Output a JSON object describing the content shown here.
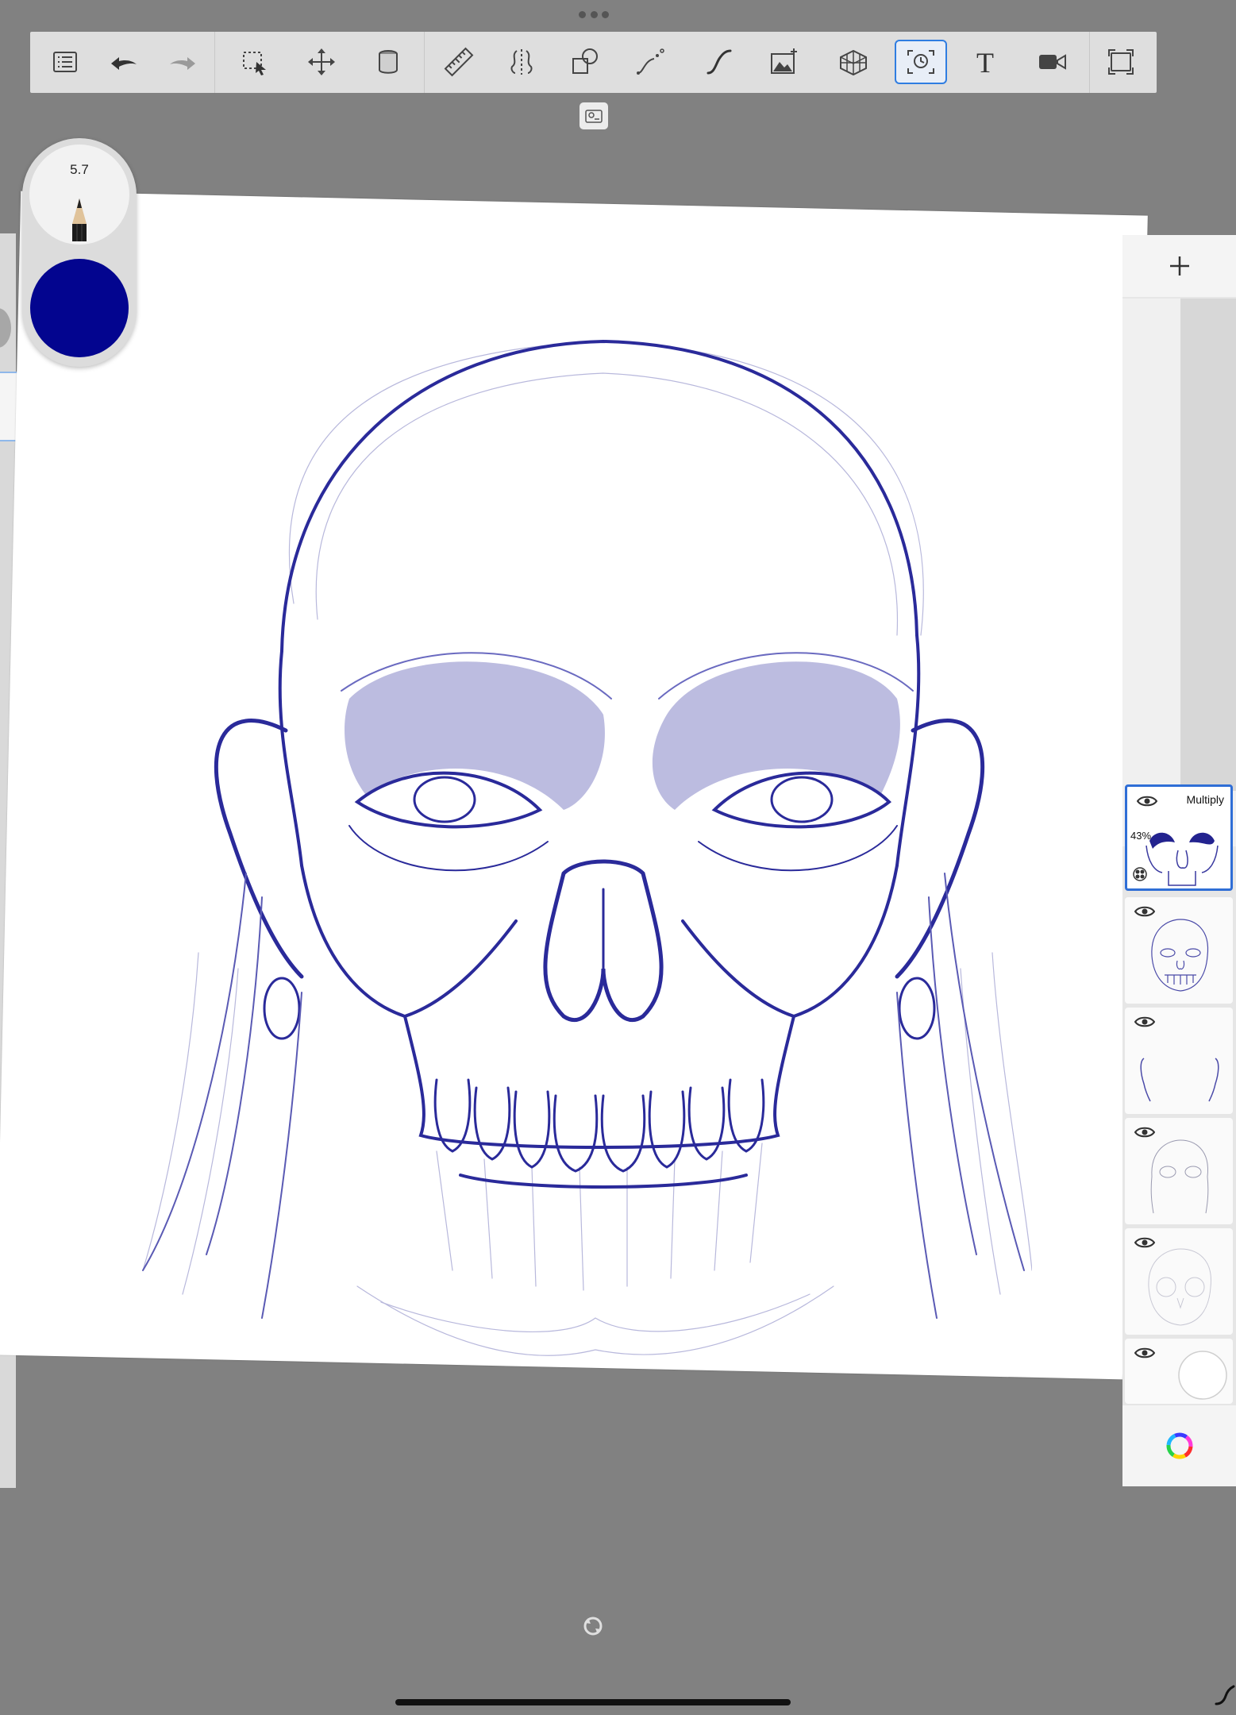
{
  "toolbar": {
    "tools": [
      {
        "name": "menu-list-icon"
      },
      {
        "name": "undo-icon"
      },
      {
        "name": "redo-icon"
      },
      {
        "name": "selection-icon"
      },
      {
        "name": "transform-icon"
      },
      {
        "name": "fill-bucket-icon"
      },
      {
        "name": "ruler-icon"
      },
      {
        "name": "symmetry-icon"
      },
      {
        "name": "shapes-icon"
      },
      {
        "name": "curve-icon"
      },
      {
        "name": "stroke-icon"
      },
      {
        "name": "add-image-icon"
      },
      {
        "name": "perspective-grid-icon"
      },
      {
        "name": "time-lapse-icon",
        "active": true
      },
      {
        "name": "text-icon"
      },
      {
        "name": "video-record-icon"
      },
      {
        "name": "fullscreen-icon"
      }
    ]
  },
  "brush": {
    "size": "5.7",
    "color": "#03058f",
    "tool": "pencil-icon"
  },
  "layers": {
    "add_label": "+",
    "items": [
      {
        "visible": true,
        "blend_mode": "Multiply",
        "opacity": "43%",
        "selected": true,
        "thumb": "eye-shadow-layer"
      },
      {
        "visible": true,
        "blend_mode": "",
        "opacity": "",
        "selected": false,
        "thumb": "skull-ink-layer"
      },
      {
        "visible": true,
        "blend_mode": "",
        "opacity": "",
        "selected": false,
        "thumb": "ears-layer"
      },
      {
        "visible": true,
        "blend_mode": "",
        "opacity": "",
        "selected": false,
        "thumb": "sketch-layer"
      },
      {
        "visible": true,
        "blend_mode": "",
        "opacity": "",
        "selected": false,
        "thumb": "rough-sketch-layer"
      },
      {
        "visible": true,
        "blend_mode": "",
        "opacity": "",
        "selected": false,
        "thumb": "background-layer"
      }
    ],
    "color_wheel": "color-wheel-icon"
  },
  "colors": {
    "ink": "#2a2a9a",
    "accent": "#2f7de1",
    "background": "#818181"
  }
}
